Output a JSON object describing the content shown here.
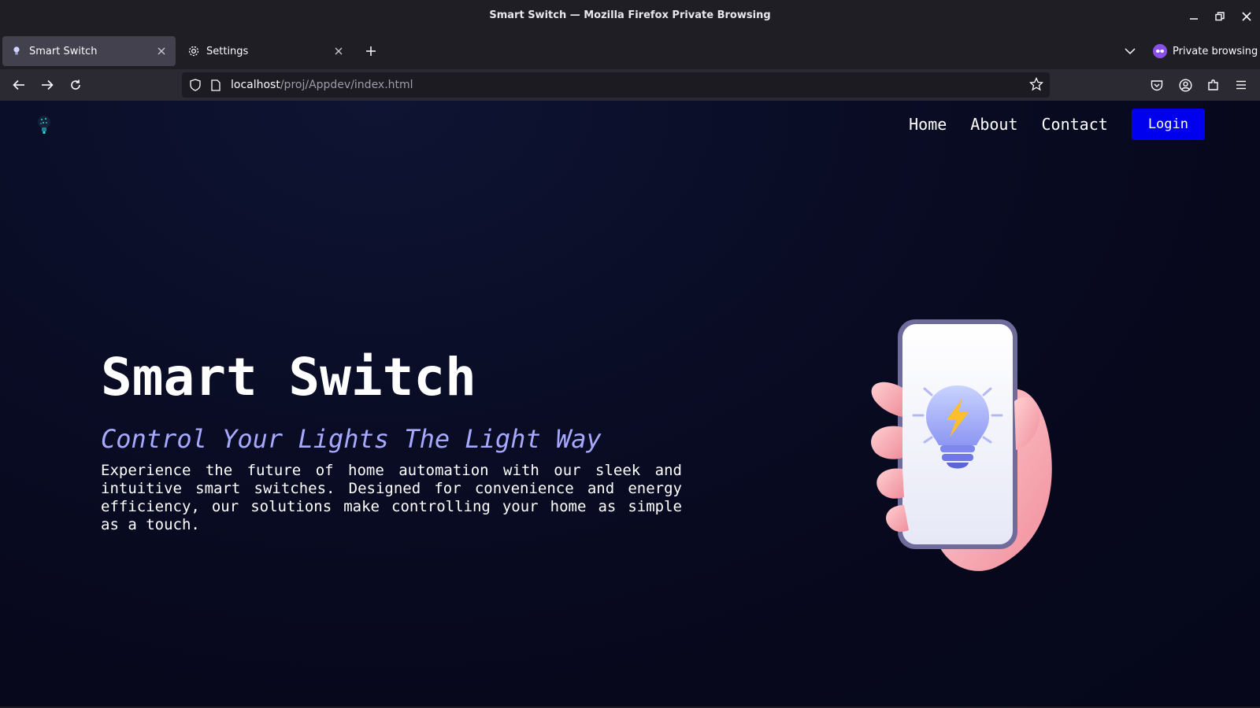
{
  "window": {
    "title": "Smart Switch — Mozilla Firefox Private Browsing"
  },
  "tabs": [
    {
      "label": "Smart Switch",
      "active": true,
      "icon": "bulb-favicon-icon"
    },
    {
      "label": "Settings",
      "active": false,
      "icon": "gear-icon"
    }
  ],
  "private_browsing": {
    "label": "Private browsing"
  },
  "urlbar": {
    "host": "localhost",
    "path": "/proj/Appdev/index.html"
  },
  "site": {
    "nav": {
      "home": "Home",
      "about": "About",
      "contact": "Contact",
      "login": "Login"
    },
    "hero": {
      "title": "Smart Switch",
      "subtitle": "Control Your Lights The Light Way",
      "description": "Experience the future of home automation with our sleek and intuitive smart switches. Designed for convenience and energy efficiency, our solutions make controlling your home as simple as a touch."
    }
  },
  "colors": {
    "page_background": "#07081c",
    "accent_subtitle": "#a7a9ff",
    "login_button": "#0000ee",
    "private_badge": "#8a4fe8"
  }
}
